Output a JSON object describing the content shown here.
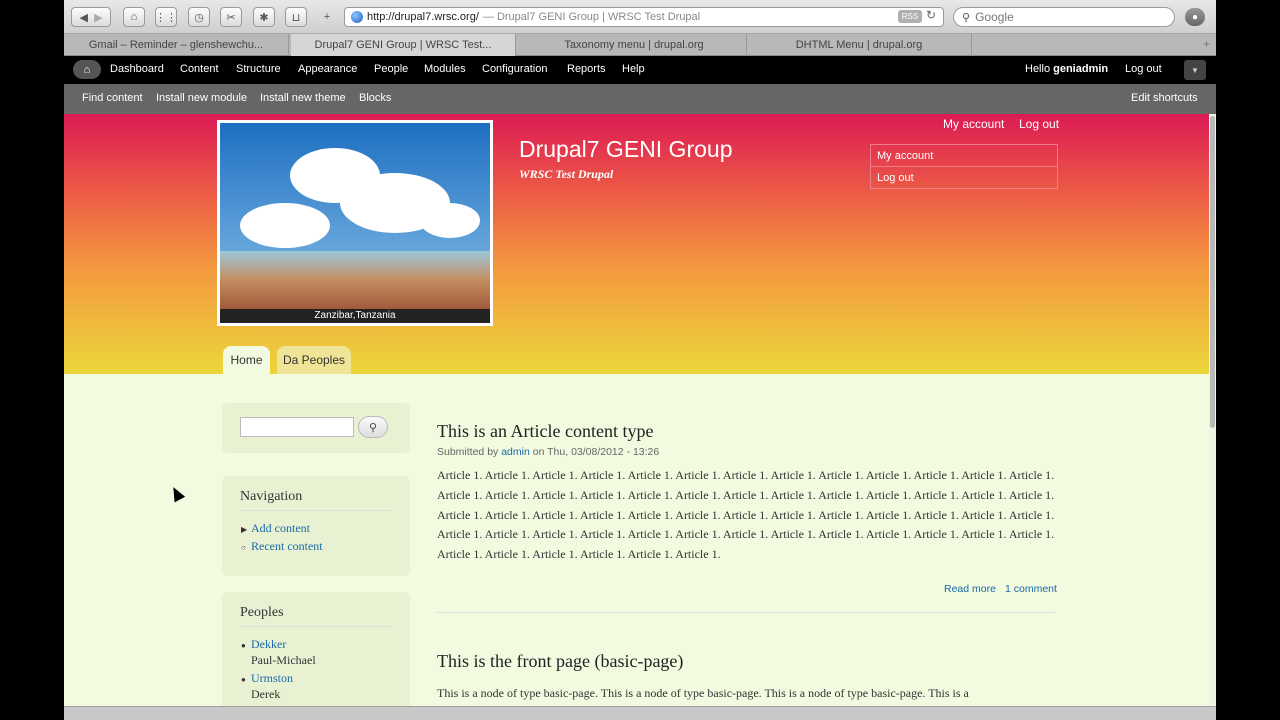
{
  "browser": {
    "url": "http://drupal7.wrsc.org/",
    "page_title": "— Drupal7 GENI Group | WRSC Test Drupal",
    "rss_label": "RSS",
    "search_placeholder": "Google",
    "tabs": [
      {
        "label": "Gmail – Reminder – glenshewchu..."
      },
      {
        "label": "Drupal7 GENI Group | WRSC Test..."
      },
      {
        "label": "Taxonomy menu | drupal.org"
      },
      {
        "label": "DHTML Menu | drupal.org"
      }
    ],
    "icons": [
      "back-icon",
      "forward-icon",
      "home-icon",
      "apps-grid-icon",
      "history-icon",
      "tools-icon",
      "puzzle-icon",
      "bookmark-icon",
      "add-tab-icon",
      "reload-icon",
      "search-icon",
      "bug-icon"
    ]
  },
  "adminbar": {
    "items": [
      "Dashboard",
      "Content",
      "Structure",
      "Appearance",
      "People",
      "Modules",
      "Configuration",
      "Reports",
      "Help"
    ],
    "hello_prefix": "Hello ",
    "username": "geniadmin",
    "logout": "Log out"
  },
  "shortcuts": {
    "items": [
      "Find content",
      "Install new module",
      "Install new theme",
      "Blocks"
    ],
    "edit": "Edit shortcuts"
  },
  "header": {
    "site_name": "Drupal7 GENI Group",
    "slogan": "WRSC Test Drupal",
    "banner_caption": "Zanzibar,Tanzania",
    "secondary_menu": [
      "My account",
      "Log out"
    ],
    "user_menu": [
      "My account",
      "Log out"
    ],
    "main_tabs": [
      "Home",
      "Da Peoples"
    ]
  },
  "sidebar": {
    "search_button_icon": "search-icon",
    "navigation": {
      "title": "Navigation",
      "items": [
        "Add content",
        "Recent content"
      ]
    },
    "peoples": {
      "title": "Peoples",
      "items": [
        {
          "last": "Dekker",
          "first": "Paul-Michael"
        },
        {
          "last": "Urmston",
          "first": "Derek"
        }
      ]
    }
  },
  "content": {
    "article": {
      "title": "This is an Article content type",
      "submitted_prefix": "Submitted by ",
      "author": "admin",
      "date": " on Thu, 03/08/2012 - 13:26",
      "body": "Article 1. Article 1. Article 1. Article 1. Article 1. Article 1. Article 1. Article 1. Article 1. Article 1. Article 1. Article 1. Article 1. Article 1. Article 1. Article 1. Article 1. Article 1. Article 1. Article 1. Article 1. Article 1. Article 1. Article 1. Article 1. Article 1. Article 1. Article 1. Article 1. Article 1. Article 1. Article 1. Article 1. Article 1. Article 1. Article 1. Article 1. Article 1. Article 1. Article 1. Article 1. Article 1. Article 1. Article 1. Article 1. Article 1. Article 1. Article 1. Article 1. Article 1. Article 1. Article 1. Article 1. Article 1. Article 1. Article 1. Article 1. Article 1.",
      "read_more": "Read more",
      "comments": "1 comment"
    },
    "page": {
      "title": "This is the front page (basic-page)",
      "body": "This is a node of type basic-page. This is a node of type basic-page. This is a node of type basic-page. This is a"
    }
  }
}
